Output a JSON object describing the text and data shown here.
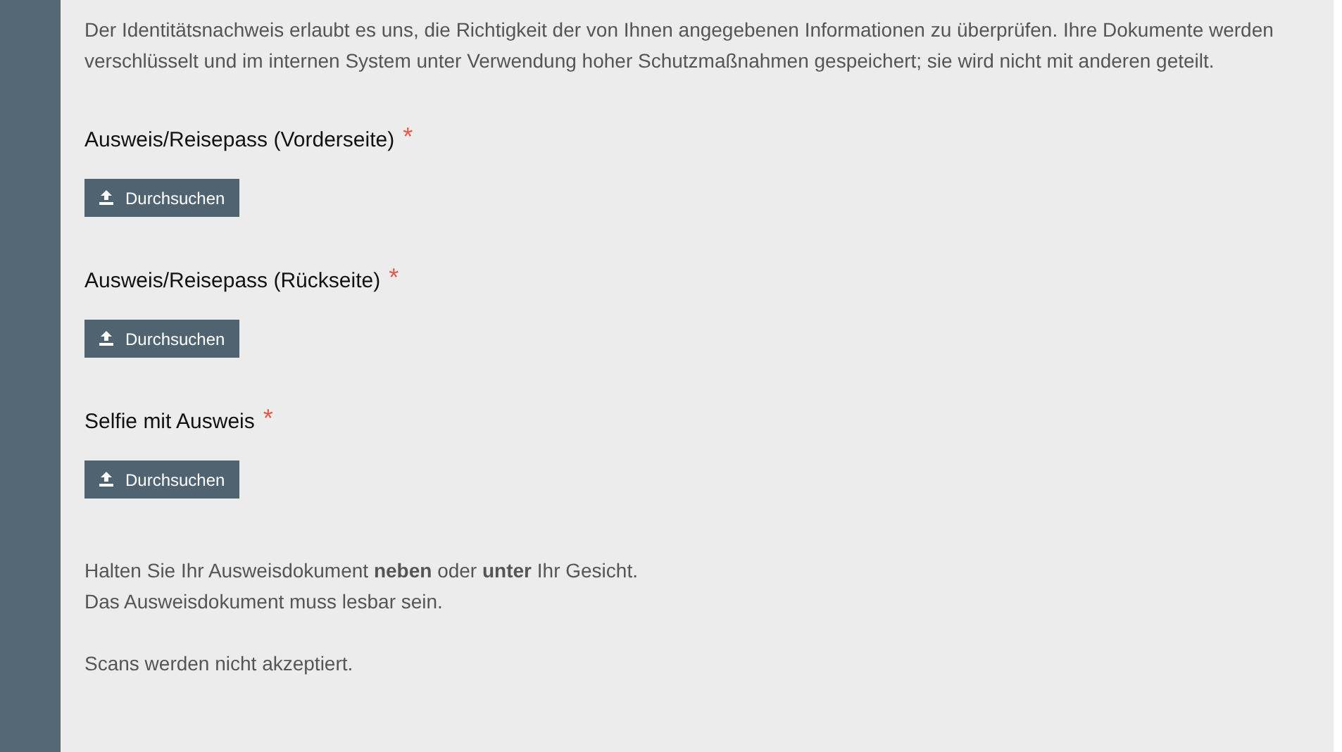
{
  "intro": "Der Identitätsnachweis erlaubt es uns, die Richtigkeit der von Ihnen angegebenen Informationen zu überprüfen. Ihre Dokumente werden verschlüsselt und im internen System unter Verwendung hoher Schutzmaßnahmen gespeichert; sie wird nicht mit anderen geteilt.",
  "uploads": [
    {
      "label": "Ausweis/Reisepass (Vorderseite)",
      "required_mark": "*",
      "button": "Durchsuchen"
    },
    {
      "label": "Ausweis/Reisepass (Rückseite)",
      "required_mark": "*",
      "button": "Durchsuchen"
    },
    {
      "label": "Selfie mit Ausweis",
      "required_mark": "*",
      "button": "Durchsuchen"
    }
  ],
  "notes": [
    "Halten Sie Ihr Ausweisdokument **neben** oder **unter** Ihr Gesicht.",
    "Das Ausweisdokument muss lesbar sein."
  ],
  "footer_note": "Scans werden nicht akzeptiert."
}
